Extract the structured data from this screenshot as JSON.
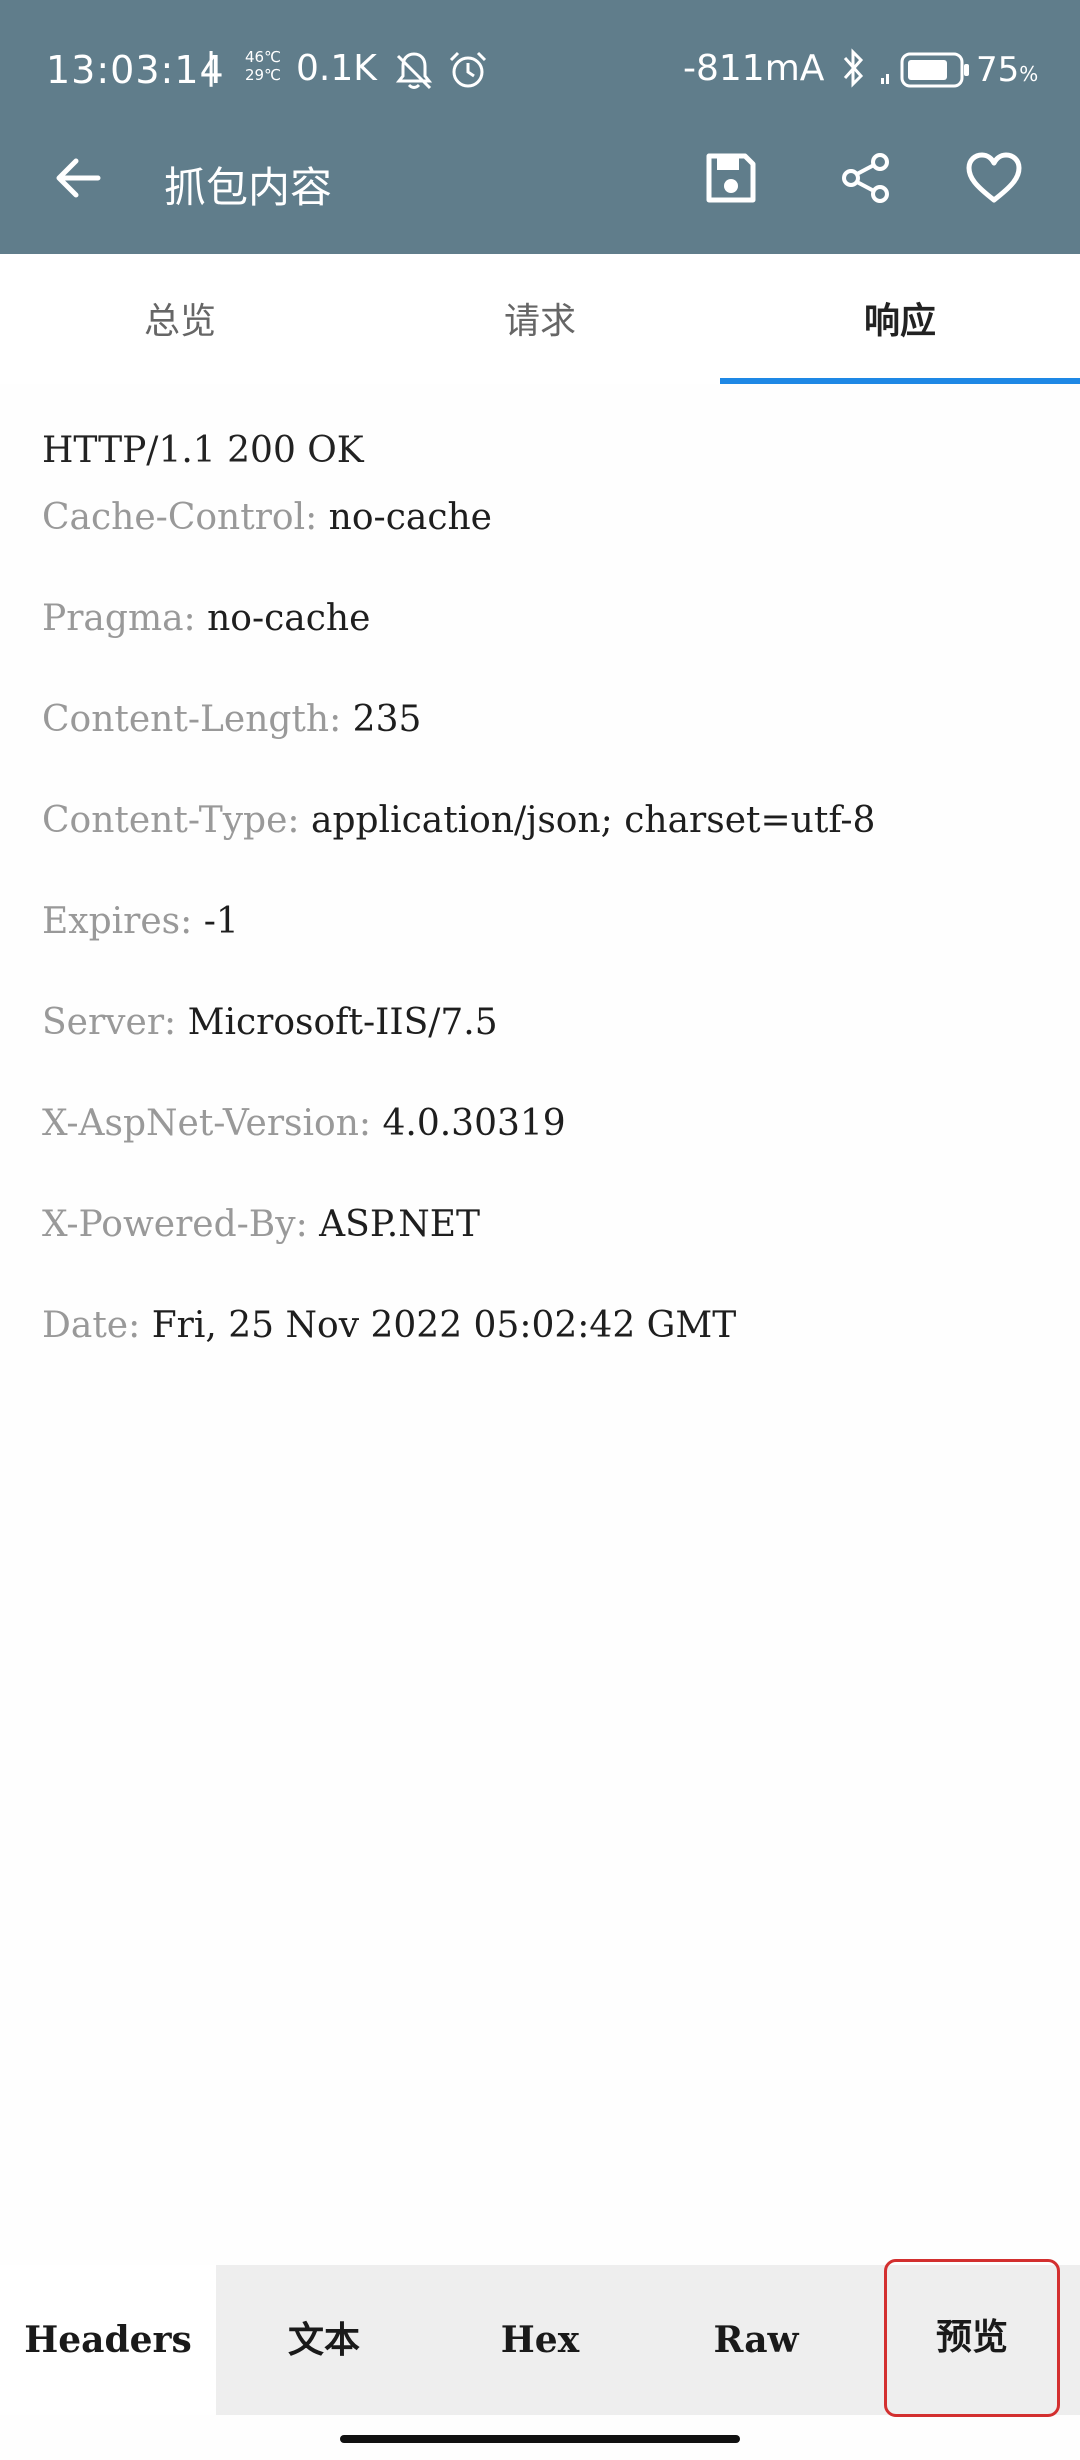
{
  "status_bar": {
    "time": "13:03:14",
    "separator": "|",
    "temp_high": "46℃",
    "temp_low": "29℃",
    "net_speed": "0.1K",
    "current": "-811mA",
    "battery_percent": "75",
    "battery_unit": "%",
    "battery_level": 0.75,
    "icons": [
      "mute-icon",
      "alarm-icon",
      "bluetooth-icon",
      "signal-icon",
      "battery-icon"
    ]
  },
  "toolbar": {
    "title": "抓包内容",
    "icons": [
      "back-arrow-icon",
      "save-icon",
      "share-icon",
      "heart-icon"
    ]
  },
  "tabs": [
    {
      "label": "总览",
      "active": false
    },
    {
      "label": "请求",
      "active": false
    },
    {
      "label": "响应",
      "active": true
    }
  ],
  "response": {
    "status_line": "HTTP/1.1 200 OK",
    "headers": [
      {
        "key": "Cache-Control",
        "sep": ": ",
        "value": "no-cache"
      },
      {
        "key": "Pragma",
        "sep": ": ",
        "value": "no-cache"
      },
      {
        "key": "Content-Length",
        "sep": ": ",
        "value": "235"
      },
      {
        "key": "Content-Type",
        "sep": ": ",
        "value": "application/json; charset=utf-8"
      },
      {
        "key": "Expires",
        "sep": ": ",
        "value": "-1"
      },
      {
        "key": "Server",
        "sep": ": ",
        "value": "Microsoft-IIS/7.5"
      },
      {
        "key": "X-AspNet-Version",
        "sep": ": ",
        "value": "4.0.30319"
      },
      {
        "key": "X-Powered-By",
        "sep": ": ",
        "value": "ASP.NET"
      },
      {
        "key": "Date",
        "sep": ": ",
        "value": "Fri, 25 Nov 2022 05:02:42 GMT"
      }
    ]
  },
  "bottom_tabs": [
    {
      "label": "Headers",
      "active": true
    },
    {
      "label": "文本",
      "active": false
    },
    {
      "label": "Hex",
      "active": false
    },
    {
      "label": "Raw",
      "active": false
    },
    {
      "label": "预览",
      "active": false
    }
  ],
  "colors": {
    "app_bar": "#607d8b",
    "tab_indicator": "#1e88e5",
    "highlight_border": "#d32f2f"
  }
}
